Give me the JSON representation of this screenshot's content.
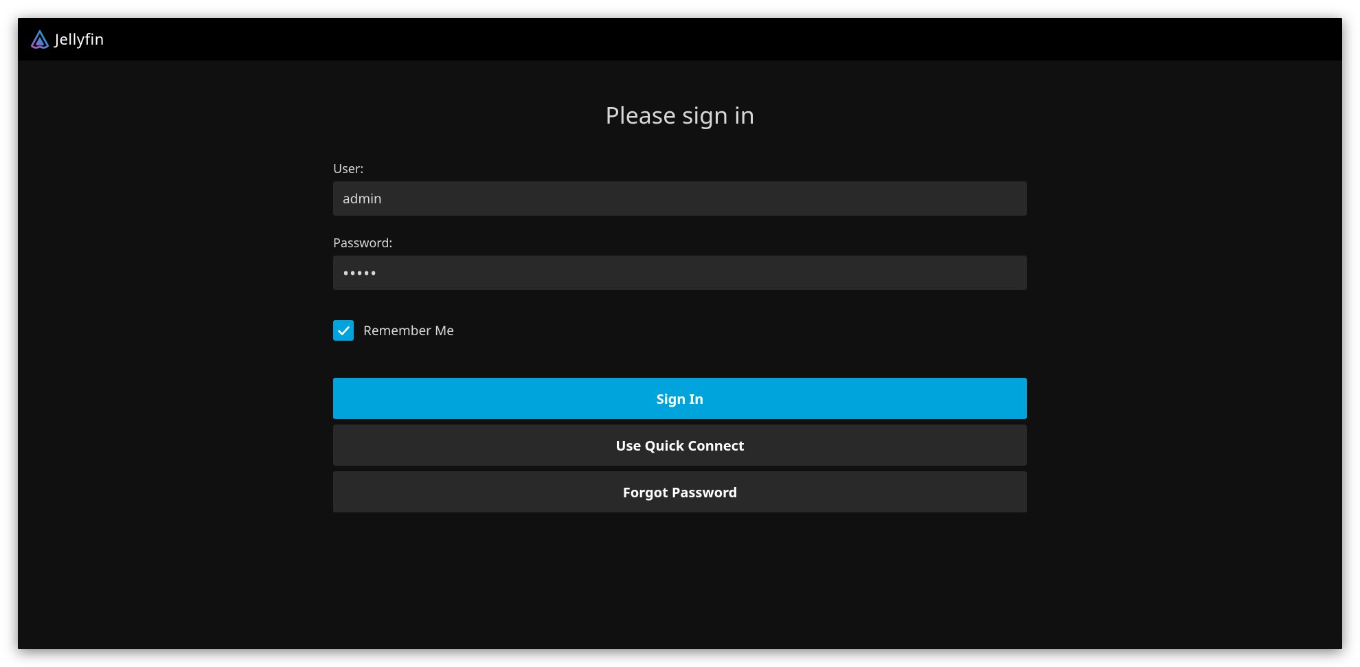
{
  "header": {
    "app_name": "Jellyfin"
  },
  "login": {
    "title": "Please sign in",
    "user_label": "User:",
    "user_value": "admin",
    "password_label": "Password:",
    "password_value": "•••••",
    "remember_label": "Remember Me",
    "remember_checked": true,
    "sign_in_button": "Sign In",
    "quick_connect_button": "Use Quick Connect",
    "forgot_password_button": "Forgot Password"
  },
  "colors": {
    "accent": "#00a4dc",
    "background": "#101010",
    "input_bg": "#292929"
  }
}
